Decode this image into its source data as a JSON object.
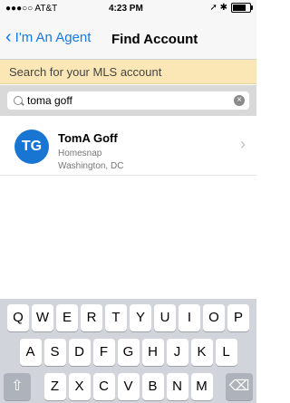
{
  "status": {
    "carrier": "●●●○○ AT&T",
    "time": "4:23 PM",
    "icons": "➚ ✱"
  },
  "nav": {
    "back_label": "I'm An Agent",
    "title": "Find Account"
  },
  "banner": {
    "text": "Search for your MLS account"
  },
  "search": {
    "value": "toma goff"
  },
  "result": {
    "initials": "TG",
    "name": "TomA Goff",
    "company": "Homesnap",
    "location": "Washington, DC"
  },
  "keyboard": {
    "row1": [
      "Q",
      "W",
      "E",
      "R",
      "T",
      "Y",
      "U",
      "I",
      "O",
      "P"
    ],
    "row2": [
      "A",
      "S",
      "D",
      "F",
      "G",
      "H",
      "J",
      "K",
      "L"
    ],
    "row3": [
      "Z",
      "X",
      "C",
      "V",
      "B",
      "N",
      "M"
    ]
  }
}
